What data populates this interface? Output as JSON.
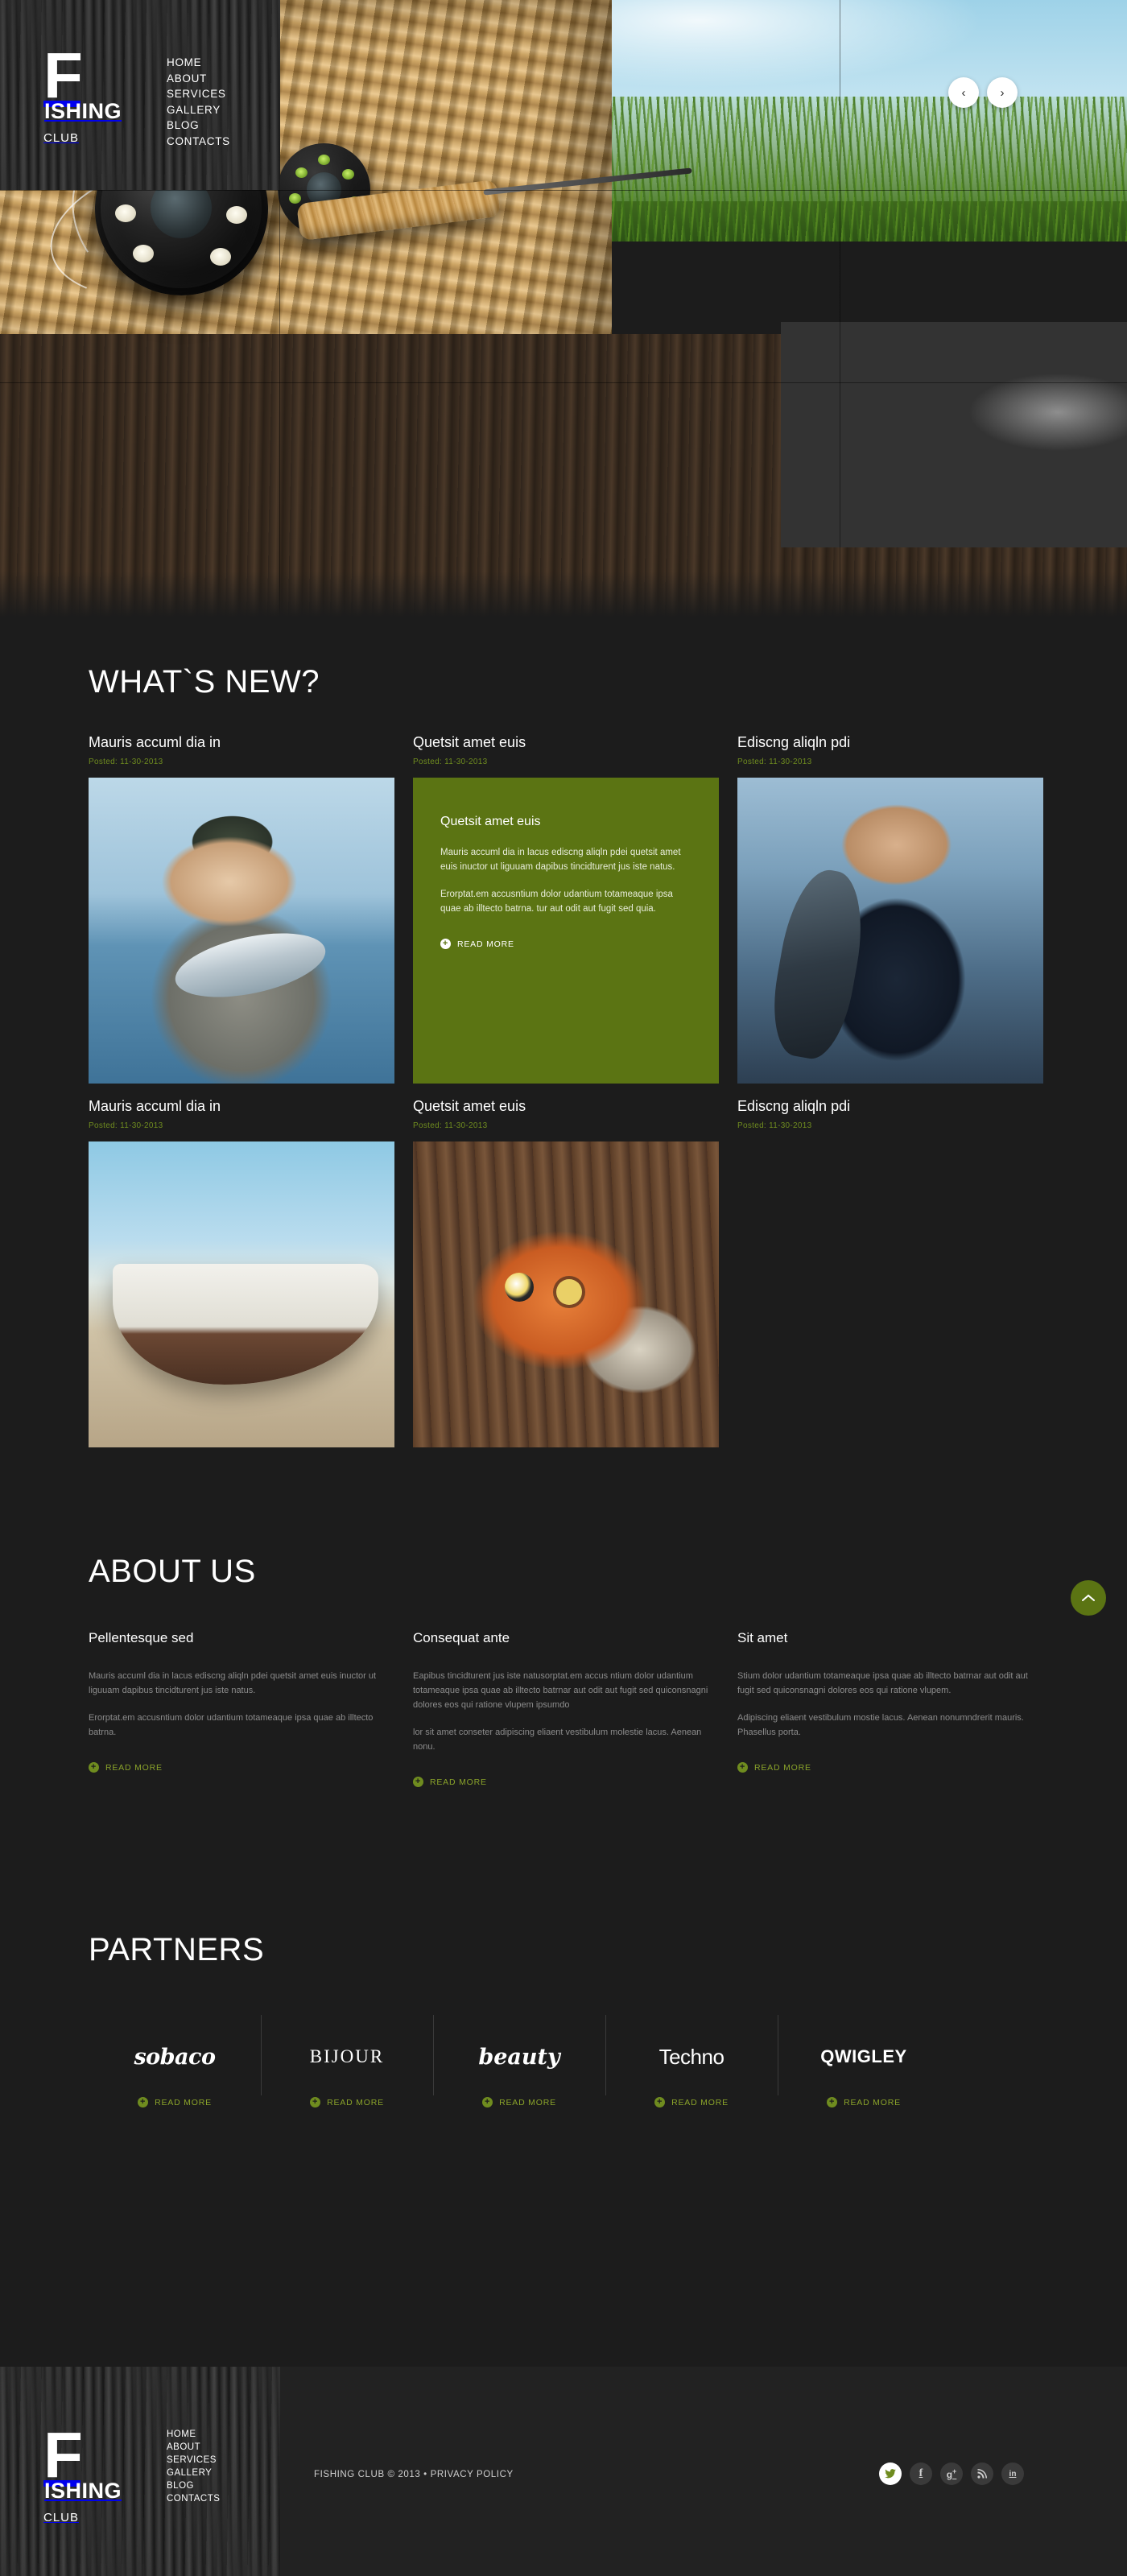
{
  "brand": {
    "logo_initial": "F",
    "logo_rest": "ISHING",
    "logo_sub": "CLUB"
  },
  "nav": {
    "items": [
      {
        "label": "HOME"
      },
      {
        "label": "ABOUT"
      },
      {
        "label": "SERVICES"
      },
      {
        "label": "GALLERY"
      },
      {
        "label": "BLOG"
      },
      {
        "label": "CONTACTS"
      }
    ]
  },
  "slider": {
    "prev_icon": "‹",
    "next_icon": "›"
  },
  "whats_new": {
    "title": "WHAT`S NEW?",
    "cards": [
      {
        "title": "Mauris accuml dia in",
        "date": "Posted: 11-30-2013",
        "thumb": "fisherman-with-fish-photo"
      },
      {
        "title": "Quetsit amet euis",
        "date": "Posted: 11-30-2013",
        "thumb": "green-text-panel"
      },
      {
        "title": "Ediscng aliqln pdi",
        "date": "Posted: 11-30-2013",
        "thumb": "man-with-tuna-photo"
      },
      {
        "title": "Mauris accuml dia in",
        "date": "Posted: 11-30-2013",
        "thumb": "beached-boat-photo"
      },
      {
        "title": "Quetsit amet euis",
        "date": "Posted: 11-30-2013",
        "thumb": "fishing-lures-photo"
      },
      {
        "title": "Ediscng aliqln pdi",
        "date": "Posted: 11-30-2013",
        "thumb": "grandfather-and-boy-photo"
      }
    ],
    "green_card": {
      "title": "Quetsit amet euis",
      "p1": "Mauris accuml dia in lacus ediscng aliqln pdei quetsit amet euis inuctor ut liguuam dapibus tincidturent jus iste natus.",
      "p2": "Erorptat.em accusntium dolor udantium totameaque ipsa quae ab illtecto batrna. tur aut odit aut fugit sed quia.",
      "read_more": "READ MORE"
    }
  },
  "about": {
    "title": "ABOUT US",
    "scroll_top_icon": "▲",
    "columns": [
      {
        "title": "Pellentesque sed",
        "p1": "Mauris accuml dia in lacus ediscng aliqln pdei quetsit amet euis inuctor ut liguuam dapibus tincidturent jus iste natus.",
        "p2": "Erorptat.em accusntium dolor udantium totameaque ipsa quae ab illtecto batrna.",
        "read_more": "READ MORE"
      },
      {
        "title": "Consequat ante",
        "p1": "Eapibus tincidturent jus iste natusorptat.em accus ntium dolor udantium totameaque ipsa quae ab illtecto batrnar aut odit aut fugit sed quiconsnagni dolores eos qui ratione vlupem ipsumdo",
        "p2": "lor sit amet conseter adipiscing eliaent vestibulum molestie lacus. Aenean nonu.",
        "read_more": "READ MORE"
      },
      {
        "title": "Sit amet",
        "p1": "Stium dolor udantium totameaque ipsa quae ab illtecto batrnar aut odit aut fugit sed quiconsnagni dolores eos qui ratione vlupem.",
        "p2": "Adipiscing eliaent vestibulum mostie lacus. Aenean nonumndrerit mauris. Phasellus porta.",
        "read_more": "READ MORE"
      }
    ]
  },
  "partners": {
    "title": "PARTNERS",
    "items": [
      {
        "name": "sobaco",
        "read_more": "READ MORE"
      },
      {
        "name": "BIJOUR",
        "read_more": "READ MORE"
      },
      {
        "name": "beauty",
        "read_more": "READ MORE"
      },
      {
        "name": "Techno",
        "read_more": "READ MORE"
      },
      {
        "name": "QWIGLEY",
        "read_more": "READ MORE"
      }
    ]
  },
  "footer": {
    "copyright": "FISHING CLUB © 2013 • PRIVACY POLICY",
    "socials": [
      {
        "name": "twitter",
        "glyph": "ᴠ"
      },
      {
        "name": "facebook",
        "glyph": "f"
      },
      {
        "name": "google-plus",
        "glyph": "g⁺"
      },
      {
        "name": "rss",
        "glyph": "◠"
      },
      {
        "name": "linkedin",
        "glyph": "in"
      }
    ]
  },
  "colors": {
    "accent_green": "#5b7413",
    "date_green": "#6f8c1f",
    "background": "#1c1c1c",
    "footer_bg": "#222222"
  }
}
